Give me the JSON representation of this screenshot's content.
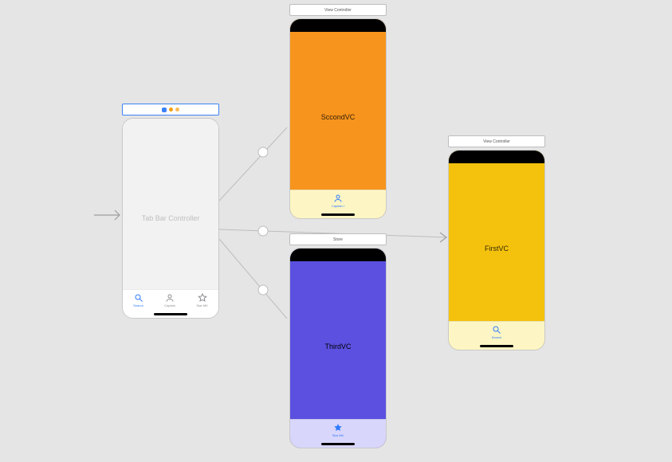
{
  "scenes": {
    "tabbar": {
      "title": "Tab Bar Controller",
      "tabs": [
        {
          "label": "Search",
          "icon": "search"
        },
        {
          "label": "Captain",
          "icon": "person"
        },
        {
          "label": "Star MK",
          "icon": "star"
        }
      ]
    },
    "second": {
      "header": "View Controller",
      "title": "SccondVC",
      "tab": {
        "label": "Captain I",
        "icon": "person"
      }
    },
    "third": {
      "header": "Store",
      "title": "ThirdVC",
      "tab": {
        "label": "Star MK",
        "icon": "star"
      }
    },
    "first": {
      "header": "View Controller",
      "title": "FirstVC",
      "tab": {
        "label": "Search",
        "icon": "search"
      }
    }
  },
  "colors": {
    "orange": "#f7941d",
    "gold": "#f4c20d",
    "purple": "#5b50e0",
    "tint": "#2f7bff"
  }
}
